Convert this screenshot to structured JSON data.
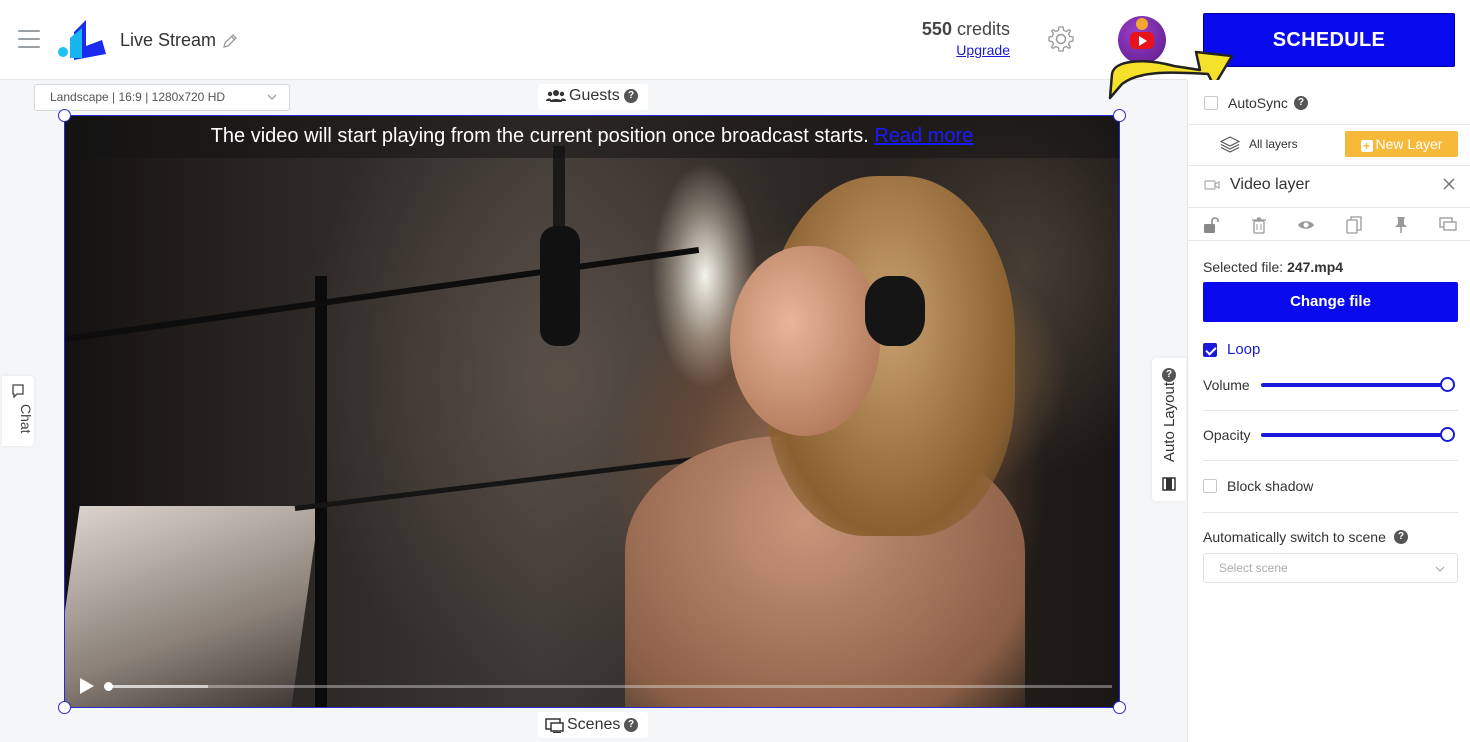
{
  "header": {
    "title": "Live Stream",
    "credits_value": "550",
    "credits_unit": "credits",
    "upgrade_label": "Upgrade",
    "schedule_label": "SCHEDULE"
  },
  "canvas": {
    "format_select": "Landscape | 16:9 | 1280x720 HD",
    "guests_label": "Guests",
    "scenes_label": "Scenes",
    "chat_label": "Chat",
    "auto_layout_label": "Auto Layout",
    "video_banner_text": "The video will start playing from the current position once broadcast starts.",
    "video_banner_link": "Read more",
    "playback_progress": 0.0
  },
  "panel": {
    "autosync_label": "AutoSync",
    "autosync_checked": false,
    "all_layers_label": "All layers",
    "new_layer_label": "New Layer",
    "layer_title": "Video layer",
    "selected_file_label": "Selected file:",
    "selected_file_name": "247.mp4",
    "change_file_label": "Change file",
    "loop_label": "Loop",
    "loop_checked": true,
    "volume_label": "Volume",
    "volume_value": 1.0,
    "opacity_label": "Opacity",
    "opacity_value": 1.0,
    "block_shadow_label": "Block shadow",
    "block_shadow_checked": false,
    "auto_switch_label": "Automatically switch to scene",
    "scene_select_placeholder": "Select scene"
  },
  "colors": {
    "primary": "#0a0aef",
    "accent_orange": "#f7b93a",
    "arrow_yellow": "#f5e02a"
  }
}
